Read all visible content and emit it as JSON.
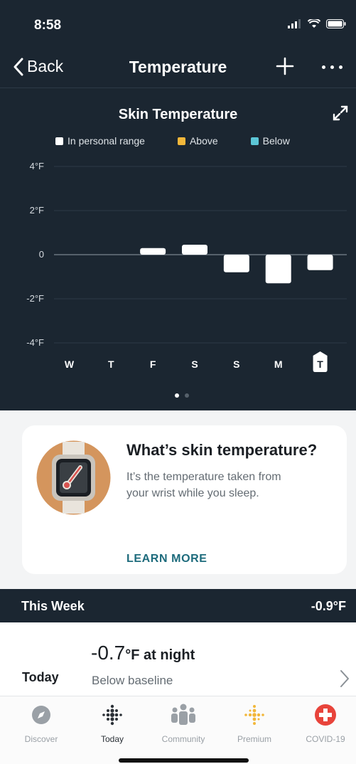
{
  "status_bar": {
    "time": "8:58"
  },
  "nav": {
    "back_label": "Back",
    "title": "Temperature"
  },
  "chart_data": {
    "type": "bar",
    "title": "Skin Temperature",
    "legend": [
      {
        "label": "In personal range",
        "color": "#ffffff"
      },
      {
        "label": "Above",
        "color": "#f2b73a"
      },
      {
        "label": "Below",
        "color": "#5cc6d6"
      }
    ],
    "categories": [
      "W",
      "T",
      "F",
      "S",
      "S",
      "M",
      "T"
    ],
    "values": [
      null,
      null,
      0.3,
      0.45,
      -0.8,
      -1.3,
      -0.7
    ],
    "ylim": [
      -4,
      4
    ],
    "yticks": [
      4,
      2,
      0,
      -2,
      -4
    ],
    "ytick_labels": [
      "4°F",
      "2°F",
      "0",
      "-2°F",
      "-4°F"
    ],
    "highlight_index": 6,
    "grid": true
  },
  "pager": {
    "pages": 2,
    "active": 0
  },
  "info_card": {
    "title": "What’s skin temperature?",
    "body": "It’s the temperature taken from your wrist while you sleep.",
    "link": "LEARN MORE"
  },
  "week": {
    "label": "This Week",
    "value": "-0.9°F"
  },
  "today": {
    "label": "Today",
    "value": "-0.7",
    "unit": "°F at night",
    "description": "Below baseline"
  },
  "tabs": [
    {
      "label": "Discover",
      "icon": "compass-icon"
    },
    {
      "label": "Today",
      "icon": "today-dots-icon",
      "active": true
    },
    {
      "label": "Community",
      "icon": "community-icon"
    },
    {
      "label": "Premium",
      "icon": "premium-icon",
      "color": "#f2b73a"
    },
    {
      "label": "COVID-19",
      "icon": "covid-cross-icon",
      "color": "#e8443b"
    }
  ]
}
